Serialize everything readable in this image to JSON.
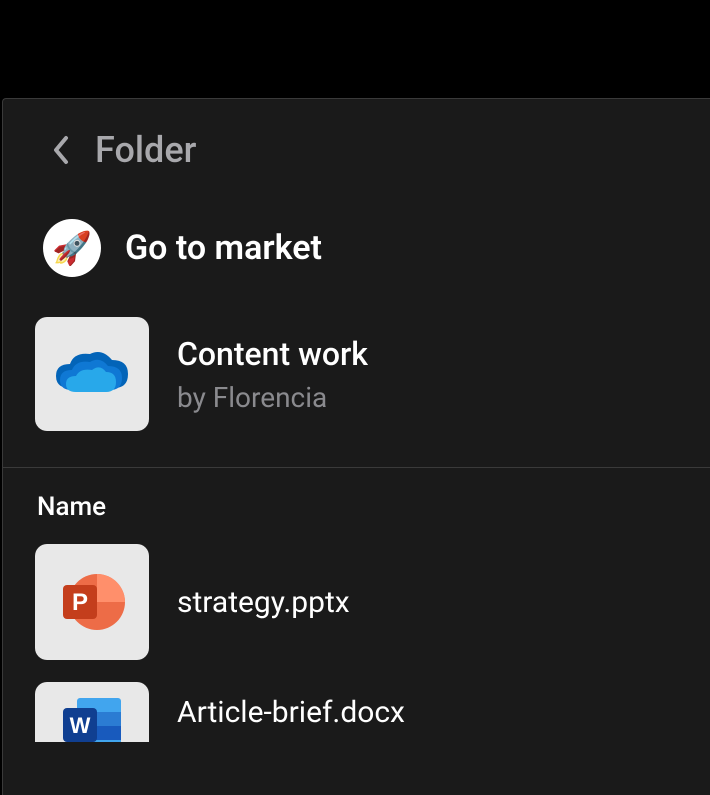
{
  "header": {
    "title": "Folder"
  },
  "breadcrumb": {
    "icon": "🚀",
    "label": "Go to market"
  },
  "folder": {
    "name": "Content work",
    "byline": "by Florencia"
  },
  "list": {
    "column_header": "Name",
    "files": [
      {
        "name": "strategy.pptx",
        "type": "pptx"
      },
      {
        "name": "Article-brief.docx",
        "type": "docx"
      }
    ]
  }
}
